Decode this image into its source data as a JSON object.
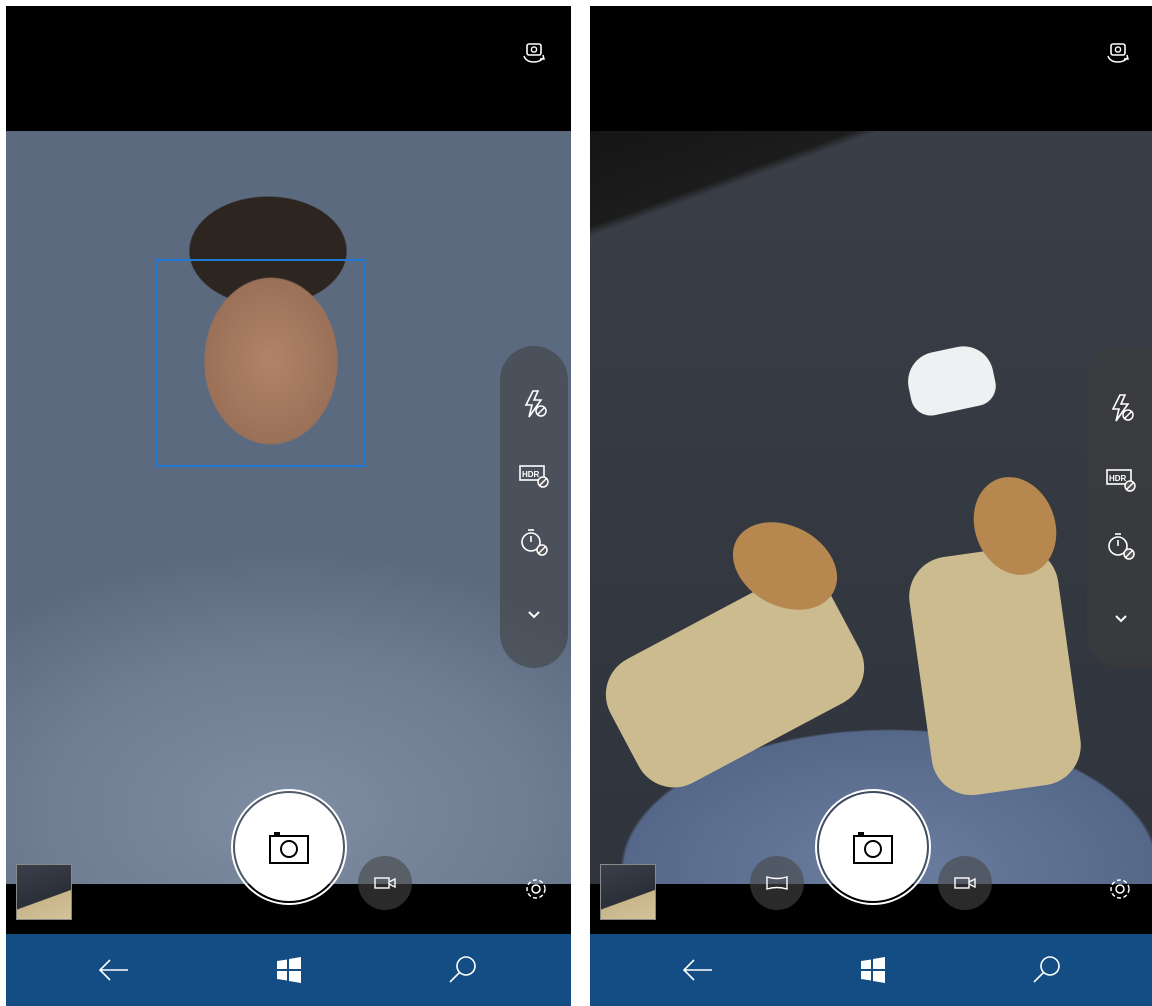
{
  "screens": [
    {
      "id": "left",
      "viewfinder": "front-camera",
      "face_detected": true,
      "top_bar": {
        "icon": "camera-switch-icon"
      },
      "options": [
        "flash-off-icon",
        "hdr-off-icon",
        "timer-off-icon",
        "chevron-down-icon"
      ],
      "mode_buttons": [
        "video-mode-icon"
      ],
      "bottom_bar": {
        "thumbnail": "last-photo-thumbnail",
        "settings_icon": "gear-icon"
      }
    },
    {
      "id": "right",
      "viewfinder": "rear-camera",
      "face_detected": false,
      "top_bar": {
        "icon": "camera-switch-icon"
      },
      "options": [
        "flash-off-icon",
        "hdr-off-icon",
        "timer-off-icon",
        "chevron-down-icon"
      ],
      "mode_buttons": [
        "panorama-mode-icon",
        "video-mode-icon"
      ],
      "bottom_bar": {
        "thumbnail": "last-photo-thumbnail",
        "settings_icon": "gear-icon"
      }
    }
  ],
  "navbar": {
    "icons": [
      "back-arrow-icon",
      "windows-start-icon",
      "search-icon"
    ]
  },
  "colors": {
    "navbar": "#144d83",
    "face_box": "#1e7ad6",
    "shutter": "#ffffff"
  }
}
